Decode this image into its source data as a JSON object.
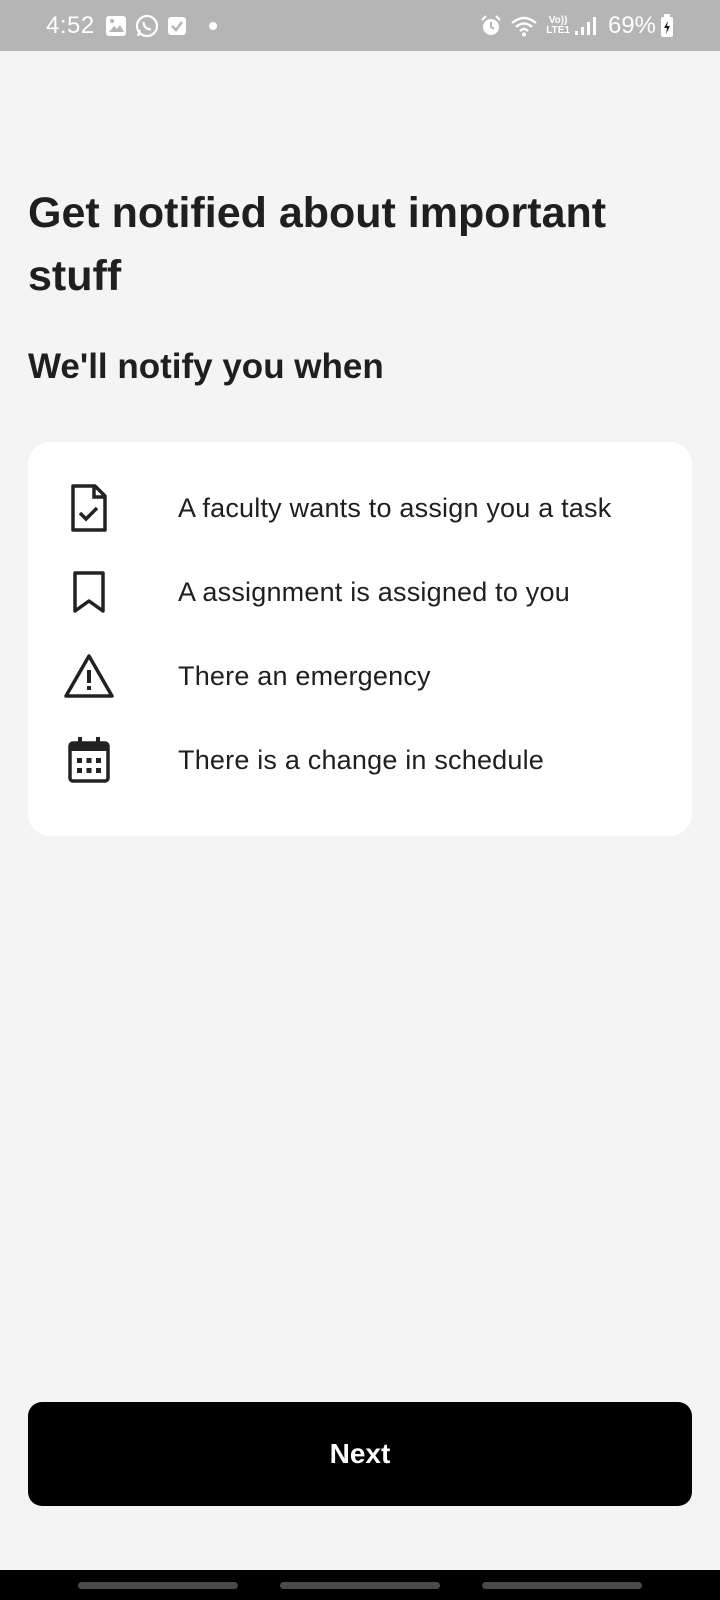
{
  "status_bar": {
    "time": "4:52",
    "battery": "69%",
    "network_top": "Vo))",
    "network_bottom": "LTE1",
    "icons": [
      "gallery-icon",
      "whatsapp-icon",
      "check-notification-icon",
      "dot-icon",
      "alarm-icon",
      "wifi-icon",
      "signal-icon",
      "battery-icon"
    ]
  },
  "header": {
    "title": "Get notified about important stuff",
    "subtitle": "We'll notify you when"
  },
  "notifications": [
    {
      "icon": "document-check-icon",
      "label": "A faculty wants to assign you a task"
    },
    {
      "icon": "bookmark-icon",
      "label": "A assignment is assigned to you"
    },
    {
      "icon": "warning-icon",
      "label": "There an emergency"
    },
    {
      "icon": "calendar-icon",
      "label": "There is a change in schedule"
    }
  ],
  "footer": {
    "next_label": "Next"
  },
  "colors": {
    "background": "#f4f4f4",
    "card": "#ffffff",
    "button": "#000000",
    "status_bar": "#b5b5b5"
  }
}
